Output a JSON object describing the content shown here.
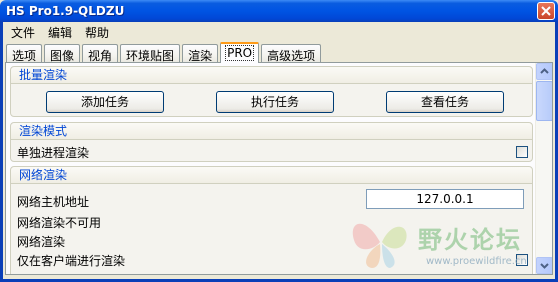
{
  "window": {
    "title": "HS Pro1.9-QLDZU"
  },
  "menu": [
    "文件",
    "编辑",
    "帮助"
  ],
  "tabs": [
    {
      "label": "选项",
      "active": false
    },
    {
      "label": "图像",
      "active": false
    },
    {
      "label": "视角",
      "active": false
    },
    {
      "label": "环境贴图",
      "active": false
    },
    {
      "label": "渲染",
      "active": false
    },
    {
      "label": "PRO",
      "active": true
    },
    {
      "label": "高级选项",
      "active": false
    }
  ],
  "batch": {
    "title": "批量渲染",
    "add_task": "添加任务",
    "run_task": "执行任务",
    "view_task": "查看任务"
  },
  "render_mode": {
    "title": "渲染模式",
    "single_process_label": "单独进程渲染",
    "single_process_checked": false
  },
  "network": {
    "title": "网络渲染",
    "host_label": "网络主机地址",
    "host_value": "127.0.0.1",
    "unavailable": "网络渲染不可用",
    "network_render": "网络渲染",
    "client_only": "仅在客户端进行渲染"
  },
  "watermark": {
    "logo_text": "野火论坛",
    "url": "www.proewildfire.cn"
  },
  "colors": {
    "title_bar": "#0054e3",
    "group_title": "#0046d5",
    "active_tab_accent": "#ff9b18"
  }
}
